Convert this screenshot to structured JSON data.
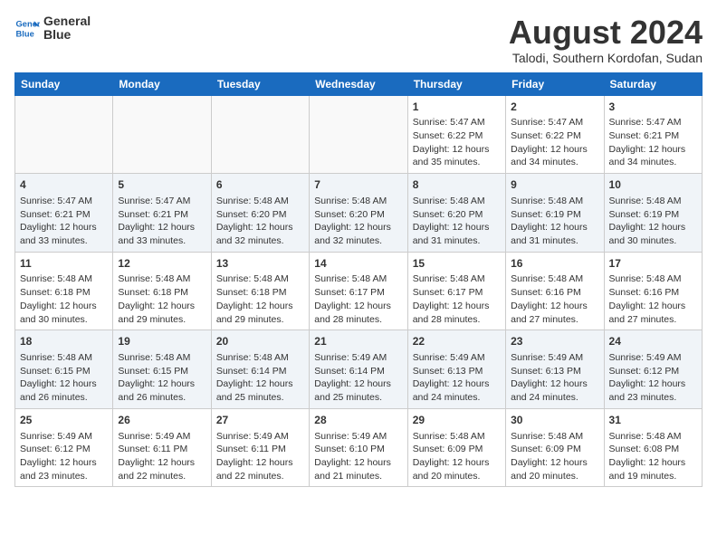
{
  "header": {
    "logo_line1": "General",
    "logo_line2": "Blue",
    "month_title": "August 2024",
    "location": "Talodi, Southern Kordofan, Sudan"
  },
  "days_of_week": [
    "Sunday",
    "Monday",
    "Tuesday",
    "Wednesday",
    "Thursday",
    "Friday",
    "Saturday"
  ],
  "weeks": [
    [
      {
        "day": "",
        "info": ""
      },
      {
        "day": "",
        "info": ""
      },
      {
        "day": "",
        "info": ""
      },
      {
        "day": "",
        "info": ""
      },
      {
        "day": "1",
        "info": "Sunrise: 5:47 AM\nSunset: 6:22 PM\nDaylight: 12 hours\nand 35 minutes."
      },
      {
        "day": "2",
        "info": "Sunrise: 5:47 AM\nSunset: 6:22 PM\nDaylight: 12 hours\nand 34 minutes."
      },
      {
        "day": "3",
        "info": "Sunrise: 5:47 AM\nSunset: 6:21 PM\nDaylight: 12 hours\nand 34 minutes."
      }
    ],
    [
      {
        "day": "4",
        "info": "Sunrise: 5:47 AM\nSunset: 6:21 PM\nDaylight: 12 hours\nand 33 minutes."
      },
      {
        "day": "5",
        "info": "Sunrise: 5:47 AM\nSunset: 6:21 PM\nDaylight: 12 hours\nand 33 minutes."
      },
      {
        "day": "6",
        "info": "Sunrise: 5:48 AM\nSunset: 6:20 PM\nDaylight: 12 hours\nand 32 minutes."
      },
      {
        "day": "7",
        "info": "Sunrise: 5:48 AM\nSunset: 6:20 PM\nDaylight: 12 hours\nand 32 minutes."
      },
      {
        "day": "8",
        "info": "Sunrise: 5:48 AM\nSunset: 6:20 PM\nDaylight: 12 hours\nand 31 minutes."
      },
      {
        "day": "9",
        "info": "Sunrise: 5:48 AM\nSunset: 6:19 PM\nDaylight: 12 hours\nand 31 minutes."
      },
      {
        "day": "10",
        "info": "Sunrise: 5:48 AM\nSunset: 6:19 PM\nDaylight: 12 hours\nand 30 minutes."
      }
    ],
    [
      {
        "day": "11",
        "info": "Sunrise: 5:48 AM\nSunset: 6:18 PM\nDaylight: 12 hours\nand 30 minutes."
      },
      {
        "day": "12",
        "info": "Sunrise: 5:48 AM\nSunset: 6:18 PM\nDaylight: 12 hours\nand 29 minutes."
      },
      {
        "day": "13",
        "info": "Sunrise: 5:48 AM\nSunset: 6:18 PM\nDaylight: 12 hours\nand 29 minutes."
      },
      {
        "day": "14",
        "info": "Sunrise: 5:48 AM\nSunset: 6:17 PM\nDaylight: 12 hours\nand 28 minutes."
      },
      {
        "day": "15",
        "info": "Sunrise: 5:48 AM\nSunset: 6:17 PM\nDaylight: 12 hours\nand 28 minutes."
      },
      {
        "day": "16",
        "info": "Sunrise: 5:48 AM\nSunset: 6:16 PM\nDaylight: 12 hours\nand 27 minutes."
      },
      {
        "day": "17",
        "info": "Sunrise: 5:48 AM\nSunset: 6:16 PM\nDaylight: 12 hours\nand 27 minutes."
      }
    ],
    [
      {
        "day": "18",
        "info": "Sunrise: 5:48 AM\nSunset: 6:15 PM\nDaylight: 12 hours\nand 26 minutes."
      },
      {
        "day": "19",
        "info": "Sunrise: 5:48 AM\nSunset: 6:15 PM\nDaylight: 12 hours\nand 26 minutes."
      },
      {
        "day": "20",
        "info": "Sunrise: 5:48 AM\nSunset: 6:14 PM\nDaylight: 12 hours\nand 25 minutes."
      },
      {
        "day": "21",
        "info": "Sunrise: 5:49 AM\nSunset: 6:14 PM\nDaylight: 12 hours\nand 25 minutes."
      },
      {
        "day": "22",
        "info": "Sunrise: 5:49 AM\nSunset: 6:13 PM\nDaylight: 12 hours\nand 24 minutes."
      },
      {
        "day": "23",
        "info": "Sunrise: 5:49 AM\nSunset: 6:13 PM\nDaylight: 12 hours\nand 24 minutes."
      },
      {
        "day": "24",
        "info": "Sunrise: 5:49 AM\nSunset: 6:12 PM\nDaylight: 12 hours\nand 23 minutes."
      }
    ],
    [
      {
        "day": "25",
        "info": "Sunrise: 5:49 AM\nSunset: 6:12 PM\nDaylight: 12 hours\nand 23 minutes."
      },
      {
        "day": "26",
        "info": "Sunrise: 5:49 AM\nSunset: 6:11 PM\nDaylight: 12 hours\nand 22 minutes."
      },
      {
        "day": "27",
        "info": "Sunrise: 5:49 AM\nSunset: 6:11 PM\nDaylight: 12 hours\nand 22 minutes."
      },
      {
        "day": "28",
        "info": "Sunrise: 5:49 AM\nSunset: 6:10 PM\nDaylight: 12 hours\nand 21 minutes."
      },
      {
        "day": "29",
        "info": "Sunrise: 5:48 AM\nSunset: 6:09 PM\nDaylight: 12 hours\nand 20 minutes."
      },
      {
        "day": "30",
        "info": "Sunrise: 5:48 AM\nSunset: 6:09 PM\nDaylight: 12 hours\nand 20 minutes."
      },
      {
        "day": "31",
        "info": "Sunrise: 5:48 AM\nSunset: 6:08 PM\nDaylight: 12 hours\nand 19 minutes."
      }
    ]
  ]
}
